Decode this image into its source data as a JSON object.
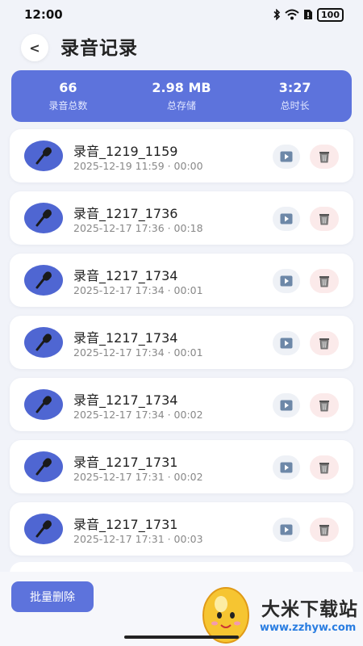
{
  "status_bar": {
    "time": "12:00",
    "battery": "100"
  },
  "header": {
    "back_symbol": "<",
    "title": "录音记录"
  },
  "stats": [
    {
      "value": "66",
      "label": "录音总数"
    },
    {
      "value": "2.98 MB",
      "label": "总存储"
    },
    {
      "value": "3:27",
      "label": "总时长"
    }
  ],
  "recordings": [
    {
      "name": "录音_1219_1159",
      "meta": "2025-12-19 11:59 · 00:00"
    },
    {
      "name": "录音_1217_1736",
      "meta": "2025-12-17 17:36 · 00:18"
    },
    {
      "name": "录音_1217_1734",
      "meta": "2025-12-17 17:34 · 00:01"
    },
    {
      "name": "录音_1217_1734",
      "meta": "2025-12-17 17:34 · 00:01"
    },
    {
      "name": "录音_1217_1734",
      "meta": "2025-12-17 17:34 · 00:02"
    },
    {
      "name": "录音_1217_1731",
      "meta": "2025-12-17 17:31 · 00:02"
    },
    {
      "name": "录音_1217_1731",
      "meta": "2025-12-17 17:31 · 00:03"
    }
  ],
  "bottom": {
    "batch_delete": "批量删除"
  },
  "watermark": {
    "title": "大米下载站",
    "url": "www.zzhyw.com"
  },
  "colors": {
    "accent": "#5d73dc",
    "mic_bg": "#4f66d2",
    "play_bg": "#eef1f6",
    "delete_bg": "#fbeaea"
  }
}
